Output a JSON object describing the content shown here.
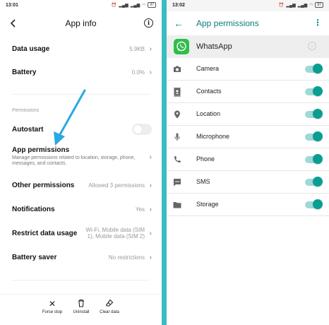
{
  "left": {
    "status": {
      "time": "13:01",
      "battery": "87"
    },
    "title": "App info",
    "rows": {
      "data_usage": {
        "label": "Data usage",
        "value": "5.9KB"
      },
      "battery": {
        "label": "Battery",
        "value": "0.0%"
      },
      "section_permissions": "Permissions",
      "autostart": {
        "label": "Autostart"
      },
      "app_permissions": {
        "label": "App permissions",
        "sub": "Manage permissions related to location, storage, phone, messages, and contacts."
      },
      "other_permissions": {
        "label": "Other permissions",
        "value": "Allowed 3 permissions"
      },
      "notifications": {
        "label": "Notifications",
        "value": "Yes"
      },
      "restrict_data": {
        "label": "Restrict data usage",
        "value": "Wi-Fi, Mobile data (SIM 1), Mobile data (SIM 2)"
      },
      "battery_saver": {
        "label": "Battery saver",
        "value": "No restrictions"
      }
    },
    "bottom": {
      "force_stop": "Force stop",
      "uninstall": "Uninstall",
      "clear_data": "Clear data"
    },
    "annotation_arrow_color": "#29a9e1"
  },
  "right": {
    "status": {
      "time": "13:02",
      "battery": "87"
    },
    "title": "App permissions",
    "app_name": "WhatsApp",
    "accent": "#0a9e93",
    "permissions": [
      {
        "label": "Camera",
        "icon": "camera-icon",
        "enabled": true
      },
      {
        "label": "Contacts",
        "icon": "contacts-icon",
        "enabled": true
      },
      {
        "label": "Location",
        "icon": "location-icon",
        "enabled": true
      },
      {
        "label": "Microphone",
        "icon": "microphone-icon",
        "enabled": true
      },
      {
        "label": "Phone",
        "icon": "phone-icon",
        "enabled": true
      },
      {
        "label": "SMS",
        "icon": "sms-icon",
        "enabled": true
      },
      {
        "label": "Storage",
        "icon": "folder-icon",
        "enabled": true
      }
    ]
  }
}
